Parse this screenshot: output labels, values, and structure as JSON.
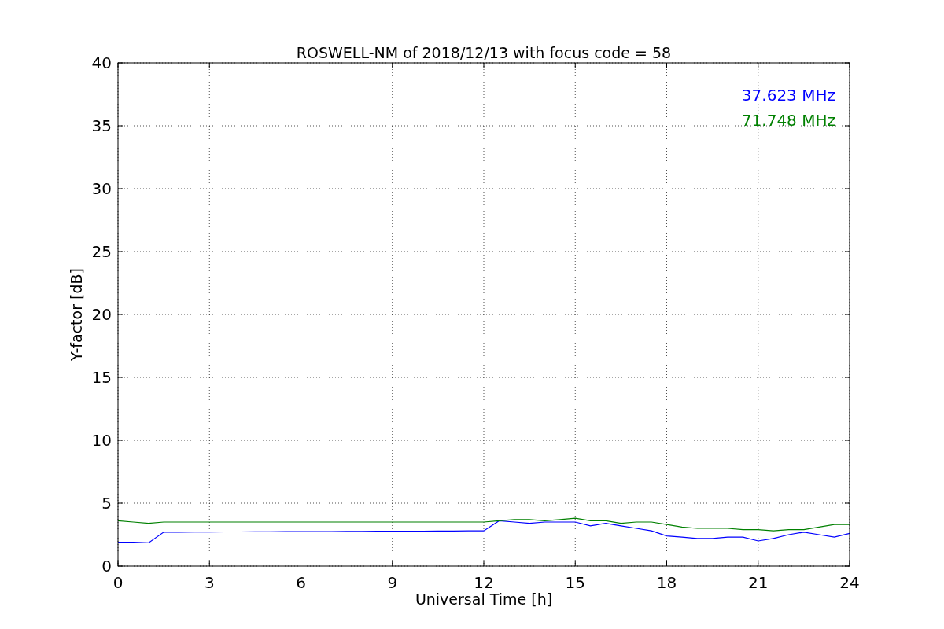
{
  "chart_data": {
    "type": "line",
    "title": "ROSWELL-NM of 2018/12/13 with focus code = 58",
    "xlabel": "Universal Time [h]",
    "ylabel": "Y-factor [dB]",
    "x": [
      0,
      0.5,
      1,
      1.5,
      2,
      2.5,
      3,
      3.5,
      4,
      4.5,
      5,
      5.5,
      6,
      6.5,
      7,
      7.5,
      8,
      8.5,
      9,
      9.5,
      10,
      10.5,
      11,
      11.5,
      12,
      12.5,
      13,
      13.5,
      14,
      14.5,
      15,
      15.5,
      16,
      16.5,
      17,
      17.5,
      18,
      18.5,
      19,
      19.5,
      20,
      20.5,
      21,
      21.5,
      22,
      22.5,
      23,
      23.5,
      24
    ],
    "series": [
      {
        "name": "37.623 MHz",
        "color": "#0000ff",
        "values": [
          1.9,
          1.9,
          1.85,
          2.7,
          2.7,
          2.71,
          2.71,
          2.72,
          2.72,
          2.73,
          2.73,
          2.74,
          2.74,
          2.75,
          2.75,
          2.76,
          2.76,
          2.77,
          2.77,
          2.78,
          2.78,
          2.79,
          2.79,
          2.8,
          2.8,
          3.6,
          3.5,
          3.4,
          3.5,
          3.5,
          3.5,
          3.2,
          3.4,
          3.2,
          3.0,
          2.8,
          2.4,
          2.3,
          2.2,
          2.2,
          2.3,
          2.3,
          2.0,
          2.2,
          2.5,
          2.7,
          2.5,
          2.3,
          2.6
        ]
      },
      {
        "name": "71.748 MHz",
        "color": "#008000",
        "values": [
          3.6,
          3.5,
          3.4,
          3.5,
          3.5,
          3.5,
          3.5,
          3.5,
          3.5,
          3.5,
          3.5,
          3.5,
          3.5,
          3.5,
          3.5,
          3.5,
          3.5,
          3.5,
          3.5,
          3.5,
          3.5,
          3.5,
          3.5,
          3.5,
          3.5,
          3.6,
          3.7,
          3.7,
          3.6,
          3.7,
          3.8,
          3.6,
          3.6,
          3.4,
          3.5,
          3.5,
          3.3,
          3.1,
          3.0,
          3.0,
          3.0,
          2.9,
          2.9,
          2.8,
          2.9,
          2.9,
          3.1,
          3.3,
          3.3
        ]
      }
    ],
    "xlim": [
      0,
      24
    ],
    "ylim": [
      0,
      40
    ],
    "grid": true,
    "xticks": [
      0,
      3,
      6,
      9,
      12,
      15,
      18,
      21,
      24
    ],
    "yticks": [
      0,
      5,
      10,
      15,
      20,
      25,
      30,
      35,
      40
    ]
  }
}
